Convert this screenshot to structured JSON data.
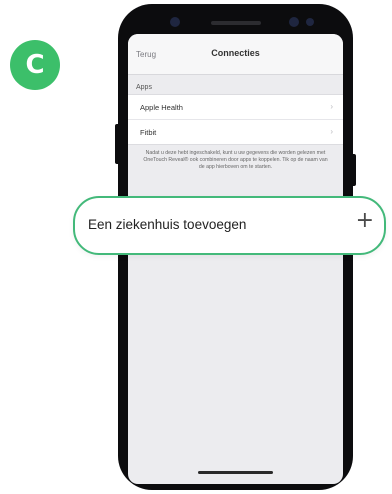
{
  "step_badge": "C",
  "app": {
    "nav": {
      "back_label": "Terug",
      "title": "Connecties"
    },
    "apps_section": {
      "header": "Apps",
      "items": [
        {
          "label": "Apple Health"
        },
        {
          "label": "Fitbit"
        }
      ]
    },
    "footnote": "Nadat u deze hebt ingeschakeld, kunt u uw gegevens die worden gelezen met OneTouch Reveal® ook combineren door apps te koppelen. Tik op de naam van de app hierboven om te starten."
  },
  "callout": {
    "label": "Een ziekenhuis toevoegen",
    "action_icon": "plus-icon"
  },
  "colors": {
    "accent_green": "#43b97a",
    "badge_green": "#3cbf6a"
  }
}
